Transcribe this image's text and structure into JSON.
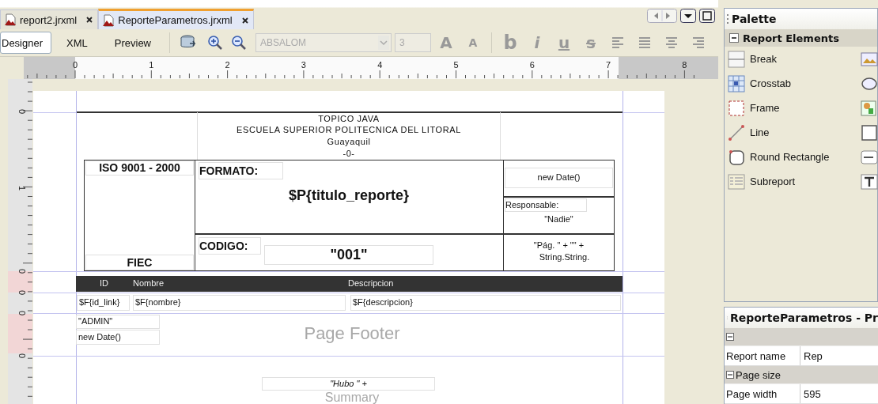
{
  "document_tabs": [
    {
      "label": "report2.jrxml",
      "selected": false
    },
    {
      "label": "ReporteParametros.jrxml",
      "selected": true
    }
  ],
  "view_tabs": [
    {
      "label": "Designer",
      "selected": true
    },
    {
      "label": "XML",
      "selected": false
    },
    {
      "label": "Preview",
      "selected": false
    }
  ],
  "toolbar": {
    "font_name": {
      "value": "ABSALOM",
      "disabled": true
    },
    "font_size": {
      "value": "3",
      "disabled": true
    },
    "format_buttons": [
      {
        "glyph": "A",
        "kind": "grow",
        "disabled": true
      },
      {
        "glyph": "A",
        "kind": "shrink",
        "disabled": true
      },
      {
        "glyph": "b",
        "kind": "bold",
        "disabled": true
      },
      {
        "glyph": "i",
        "kind": "italic",
        "disabled": true
      },
      {
        "glyph": "u",
        "kind": "underline",
        "disabled": true
      },
      {
        "glyph": "s",
        "kind": "strike",
        "disabled": true
      }
    ]
  },
  "ruler": {
    "marks": [
      "0",
      "1",
      "2",
      "3",
      "4",
      "5",
      "6",
      "7",
      "8"
    ]
  },
  "vertical_ruler": {
    "marks": [
      "0",
      "1",
      "0",
      "0",
      "0",
      "0"
    ]
  },
  "report": {
    "title_lines": [
      "TOPICO JAVA",
      "ESCUELA SUPERIOR POLITECNICA DEL LITORAL",
      "Guayaquil",
      "-0-"
    ],
    "iso_label": "ISO 9001 - 2000",
    "fiec_label": "FIEC",
    "formato_label": "FORMATO:",
    "titulo_field": "$P{titulo_reporte}",
    "codigo_label": "CODIGO:",
    "codigo_value": "\"001\"",
    "date_field": "new Date()",
    "responsable_label": "Responsable:",
    "responsable_value": "\"Nadie\"",
    "page_expression": [
      "\"Pág. \" + \"\" +",
      "String.String."
    ],
    "column_headers": [
      "ID",
      "Nombre",
      "Descripcion"
    ],
    "detail_fields": [
      "$F{id_link}",
      "$F{nombre}",
      "$F{descripcion}"
    ],
    "footer_fields": [
      "\"ADMIN\"",
      "new Date()"
    ],
    "summary_field": "\"Hubo \" +",
    "band_labels": [
      "Page Footer",
      "Summary"
    ]
  },
  "palette": {
    "title": "Palette",
    "group": {
      "label": "Report Elements",
      "expanded": true
    },
    "items": [
      "Break",
      "Crosstab",
      "Frame",
      "Line",
      "Round Rectangle",
      "Subreport"
    ]
  },
  "properties": {
    "title": "ReporteParametros - Pr",
    "rows": [
      {
        "kind": "category",
        "label": "",
        "expanded": true
      },
      {
        "kind": "property",
        "label": "Report name",
        "value": "Rep"
      },
      {
        "kind": "category",
        "label": "Page size",
        "expanded": true
      },
      {
        "kind": "property",
        "label": "Page width",
        "value": "595"
      }
    ]
  }
}
